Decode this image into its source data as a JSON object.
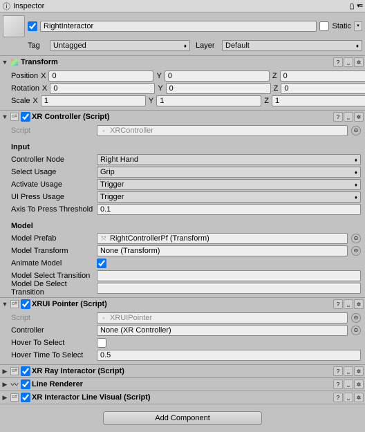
{
  "titlebar": {
    "title": "Inspector"
  },
  "header": {
    "name": "RightInteractor",
    "static_label": "Static",
    "tag_label": "Tag",
    "tag_value": "Untagged",
    "layer_label": "Layer",
    "layer_value": "Default"
  },
  "transform": {
    "title": "Transform",
    "position_label": "Position",
    "rotation_label": "Rotation",
    "scale_label": "Scale",
    "x": "X",
    "y": "Y",
    "z": "Z",
    "pos": {
      "x": "0",
      "y": "0",
      "z": "0"
    },
    "rot": {
      "x": "0",
      "y": "0",
      "z": "0"
    },
    "scl": {
      "x": "1",
      "y": "1",
      "z": "1"
    }
  },
  "xrcontroller": {
    "title": "XR Controller (Script)",
    "script_label": "Script",
    "script_value": "XRController",
    "input_header": "Input",
    "controller_node_label": "Controller Node",
    "controller_node_value": "Right Hand",
    "select_usage_label": "Select Usage",
    "select_usage_value": "Grip",
    "activate_usage_label": "Activate Usage",
    "activate_usage_value": "Trigger",
    "ui_press_usage_label": "UI Press Usage",
    "ui_press_usage_value": "Trigger",
    "axis_threshold_label": "Axis To Press Threshold",
    "axis_threshold_value": "0.1",
    "model_header": "Model",
    "model_prefab_label": "Model Prefab",
    "model_prefab_value": "RightControllerPf (Transform)",
    "model_transform_label": "Model Transform",
    "model_transform_value": "None (Transform)",
    "animate_model_label": "Animate Model",
    "model_select_label": "Model Select Transition",
    "model_deselect_label": "Model De Select Transition"
  },
  "xrui": {
    "title": "XRUI Pointer (Script)",
    "script_label": "Script",
    "script_value": "XRUIPointer",
    "controller_label": "Controller",
    "controller_value": "None (XR Controller)",
    "hover_label": "Hover To Select",
    "hover_time_label": "Hover Time To Select",
    "hover_time_value": "0.5"
  },
  "collapsed": {
    "ray": "XR Ray Interactor (Script)",
    "line": "Line Renderer",
    "linevis": "XR Interactor Line Visual (Script)"
  },
  "add_component": "Add Component"
}
